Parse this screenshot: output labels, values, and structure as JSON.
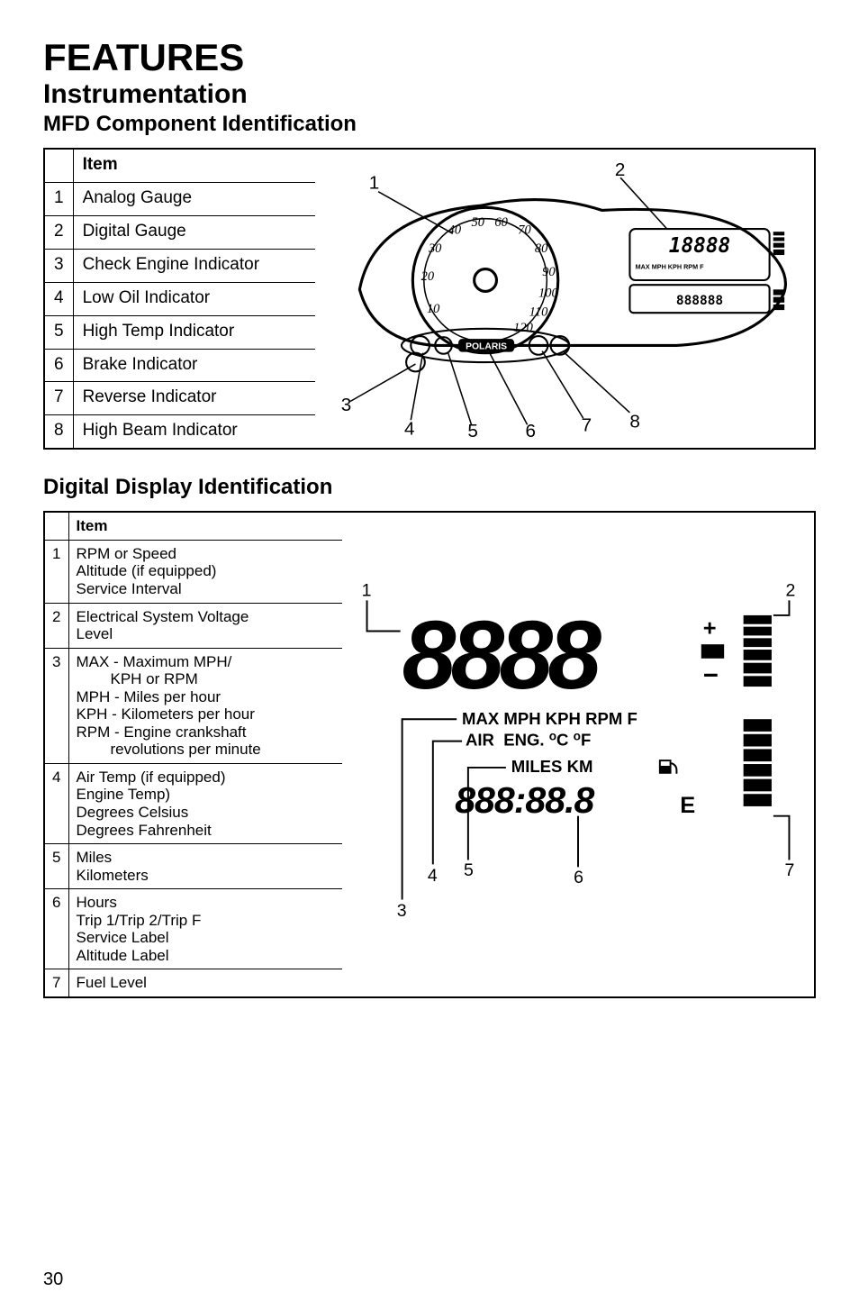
{
  "headings": {
    "features": "FEATURES",
    "instrumentation": "Instrumentation",
    "mfd": "MFD Component Identification",
    "digital": "Digital Display Identification"
  },
  "table1": {
    "header_blank": "",
    "header_item": "Item",
    "rows": [
      {
        "n": "1",
        "t": "Analog Gauge"
      },
      {
        "n": "2",
        "t": "Digital Gauge"
      },
      {
        "n": "3",
        "t": "Check Engine Indicator"
      },
      {
        "n": "4",
        "t": "Low Oil Indicator"
      },
      {
        "n": "5",
        "t": "High Temp Indicator"
      },
      {
        "n": "6",
        "t": "Brake Indicator"
      },
      {
        "n": "7",
        "t": "Reverse Indicator"
      },
      {
        "n": "8",
        "t": "High Beam Indicator"
      }
    ]
  },
  "diagram1": {
    "labels": [
      "1",
      "2",
      "3",
      "4",
      "5",
      "6",
      "7",
      "8"
    ],
    "brand": "POLARIS",
    "dial_nums": [
      "10",
      "20",
      "30",
      "40",
      "50",
      "60",
      "70",
      "80",
      "90",
      "100",
      "110",
      "120"
    ],
    "small_disp": "888888"
  },
  "table2": {
    "header_blank": "",
    "header_item": "Item",
    "rows": [
      {
        "n": "1",
        "lines": [
          "RPM or Speed",
          "Altitude (if equipped)",
          "Service Interval"
        ]
      },
      {
        "n": "2",
        "lines": [
          "Electrical System Voltage",
          "Level"
        ]
      },
      {
        "n": "3",
        "lines": [
          "MAX - Maximum MPH/",
          "<KPH or RPM>",
          "MPH - Miles per hour",
          "KPH - Kilometers per hour",
          "RPM - Engine crankshaft",
          "<revolutions per minute>"
        ]
      },
      {
        "n": "4",
        "lines": [
          "Air Temp (if equipped)",
          "Engine Temp)",
          "Degrees Celsius",
          "Degrees Fahrenheit"
        ]
      },
      {
        "n": "5",
        "lines": [
          "Miles",
          "Kilometers"
        ]
      },
      {
        "n": "6",
        "lines": [
          "Hours",
          "Trip 1/Trip 2/Trip F",
          "Service Label",
          "Altitude Label"
        ]
      },
      {
        "n": "7",
        "lines": [
          "Fuel Level"
        ]
      }
    ]
  },
  "diagram2": {
    "big": "8888",
    "line_units": "MAX MPH KPH RPM F",
    "line_air": "AIR  ENG. °C °F",
    "line_miles": "MILES KM",
    "small": "888:88.8",
    "e": "E",
    "plus": "+",
    "minus": "−",
    "labels": [
      "1",
      "2",
      "3",
      "4",
      "5",
      "6",
      "7"
    ]
  },
  "page": "30"
}
